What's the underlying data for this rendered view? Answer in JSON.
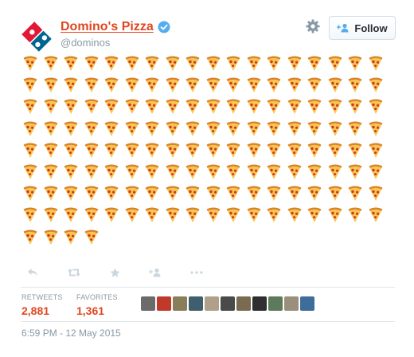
{
  "tweet": {
    "display_name": "Domino's Pizza",
    "handle": "@dominos",
    "follow_label": "Follow",
    "pizza_rows": [
      18,
      18,
      18,
      18,
      18,
      18,
      18,
      18,
      4
    ],
    "retweets_label": "RETWEETS",
    "retweets_count": "2,881",
    "favorites_label": "FAVORITES",
    "favorites_count": "1,361",
    "timestamp": "6:59 PM - 12 May 2015",
    "favoriter_avatar_colors": [
      "#6b6b6b",
      "#c0392b",
      "#8a7d5a",
      "#3f5f6e",
      "#b0a08a",
      "#4a4a4a",
      "#7a6a50",
      "#2f2f2f",
      "#5d7b5a",
      "#9a8f7a",
      "#3e6d9c"
    ]
  },
  "colors": {
    "brand_red": "#e0461f",
    "brand_blue": "#006491",
    "secondary_text": "#8899a6",
    "divider": "#e1e8ed"
  },
  "icons": [
    "dominos-logo",
    "verified-badge-icon",
    "gear-icon",
    "add-user-icon",
    "pizza-slice-icon",
    "reply-icon",
    "retweet-icon",
    "favorite-star-icon",
    "follow-icon",
    "more-icon"
  ]
}
